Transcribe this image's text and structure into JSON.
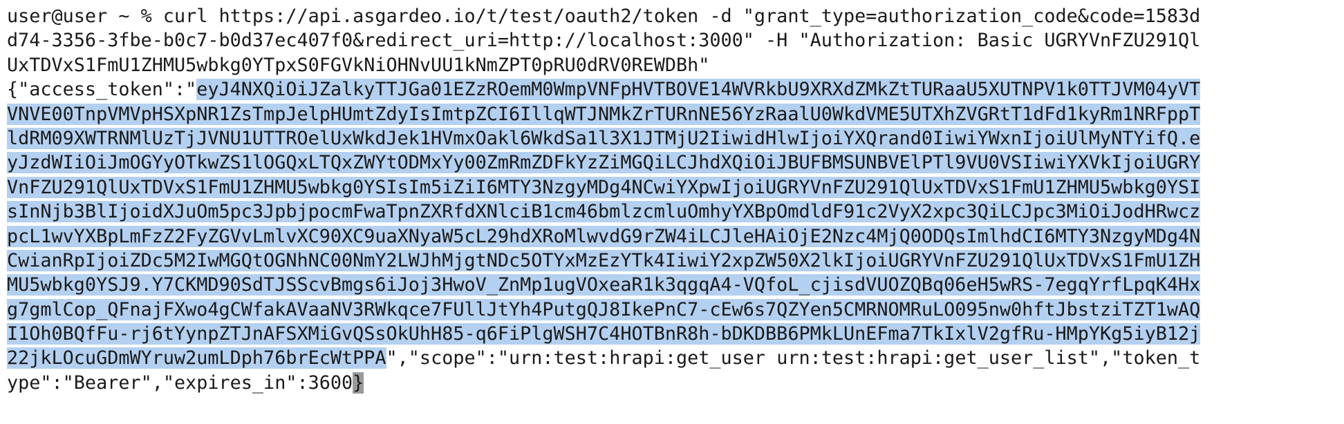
{
  "terminal": {
    "lines": [
      {
        "plain": "user@user ~ % curl https://api.asgardeo.io/t/test/oauth2/token -d \"grant_type=authorization_code&code=1583d",
        "sel": "",
        "after": "",
        "cursor": ""
      },
      {
        "plain": "d74-3356-3fbe-b0c7-b0d37ec407f0&redirect_uri=http://localhost:3000\" -H \"Authorization: Basic UGRYVnFZU291Ql",
        "sel": "",
        "after": "",
        "cursor": ""
      },
      {
        "plain": "UxTDVxS1FmU1ZHMU5wbkg0YTpxS0FGVkNiOHNvUU1kNmZPT0pRU0dRV0REWDBh\"",
        "sel": "",
        "after": "",
        "cursor": ""
      },
      {
        "plain": "{\"access_token\":\"",
        "sel": "eyJ4NXQiOiJZalkyTTJGa01EZzROemM0WmpVNFpHVTBOVE14WVRkbU9XRXdZMkZtTURaaU5XUTNPV1k0TTJVM04yVT",
        "after": "",
        "cursor": ""
      },
      {
        "plain": "",
        "sel": "VNVE00TnpVMVpHSXpNR1ZsTmpJelpHUmtZdyIsImtpZCI6IllqWTJNMkZrTURnNE56YzRaalU0WkdVME5UTXhZVGRtT1dFd1kyRm1NRFppT",
        "after": "",
        "cursor": ""
      },
      {
        "plain": "",
        "sel": "ldRM09XWTRNMlUzTjJVNU1UTTROelUxWkdJek1HVmxOakl6WkdSa1l3X1JTMjU2IiwidHlwIjoiYXQrand0IiwiYWxnIjoiUlMyNTYifQ.e",
        "after": "",
        "cursor": ""
      },
      {
        "plain": "",
        "sel": "yJzdWIiOiJmOGYyOTkwZS1lOGQxLTQxZWYtODMxYy00ZmRmZDFkYzZiMGQiLCJhdXQiOiJBUFBMSUNBVElPTl9VU0VSIiwiYXVkIjoiUGRY",
        "after": "",
        "cursor": ""
      },
      {
        "plain": "",
        "sel": "VnFZU291QlUxTDVxS1FmU1ZHMU5wbkg0YSIsIm5iZiI6MTY3NzgyMDg4NCwiYXpwIjoiUGRYVnFZU291QlUxTDVxS1FmU1ZHMU5wbkg0YSI",
        "after": "",
        "cursor": ""
      },
      {
        "plain": "",
        "sel": "sInNjb3BlIjoidXJuOm5pc3JpbjpocmFwaTpnZXRfdXNlciB1cm46bmlzcmluOmhyYXBpOmdldF91c2VyX2xpc3QiLCJpc3MiOiJodHRwcz",
        "after": "",
        "cursor": ""
      },
      {
        "plain": "",
        "sel": "pcL1wvYXBpLmFzZ2FyZGVvLmlvXC90XC9uaXNyaW5cL29hdXRoMlwvdG9rZW4iLCJleHAiOjE2Nzc4MjQ0ODQsImlhdCI6MTY3NzgyMDg4N",
        "after": "",
        "cursor": ""
      },
      {
        "plain": "",
        "sel": "CwianRpIjoiZDc5M2IwMGQtOGNhNC00NmY2LWJhMjgtNDc5OTYxMzEzYTk4IiwiY2xpZW50X2lkIjoiUGRYVnFZU291QlUxTDVxS1FmU1ZH",
        "after": "",
        "cursor": ""
      },
      {
        "plain": "",
        "sel": "MU5wbkg0YSJ9.Y7CKMD90SdTJSScvBmgs6iJoj3HwoV_ZnMp1ugVOxeaR1k3qgqA4-VQfoL_cjisdVUOZQBq06eH5wRS-7egqYrfLpqK4Hx",
        "after": "",
        "cursor": ""
      },
      {
        "plain": "",
        "sel": "g7gmlCop_QFnajFXwo4gCWfakAVaaNV3RWkqce7FUllJtYh4PutgQJ8IkePnC7-cEw6s7QZYen5CMRNOMRuLO095nw0hftJbstziTZT1wAQ",
        "after": "",
        "cursor": ""
      },
      {
        "plain": "",
        "sel": "I1Oh0BQfFu-rj6tYynpZTJnAFSXMiGvQSsOkUhH85-q6FiPlgWSH7C4HOTBnR8h-bDKDBB6PMkLUnEFma7TkIxlV2gfRu-HMpYKg5iyB12j",
        "after": "",
        "cursor": ""
      },
      {
        "plain": "",
        "sel": "22jkLOcuGDmWYruw2umLDph76brEcWtPPA",
        "after": "\",\"scope\":\"urn:test:hrapi:get_user urn:test:hrapi:get_user_list\",\"token_t",
        "cursor": ""
      },
      {
        "plain": "ype\":\"Bearer\",\"expires_in\":3600",
        "sel": "",
        "after": "",
        "cursor": "}"
      }
    ]
  }
}
